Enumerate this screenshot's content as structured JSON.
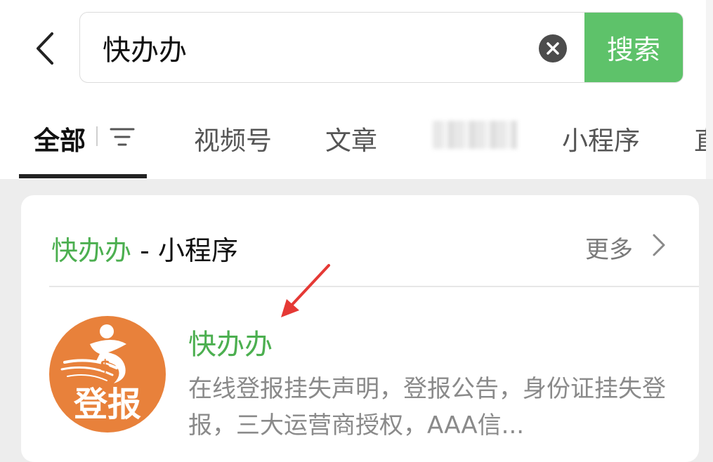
{
  "search": {
    "query": "快办办",
    "button_label": "搜索"
  },
  "tabs": [
    {
      "label": "全部"
    },
    {
      "label": "视频号"
    },
    {
      "label": "文章"
    },
    {
      "label": "小程序"
    },
    {
      "label": "直"
    }
  ],
  "section": {
    "keyword": "快办办",
    "suffix": " - 小程序",
    "more_label": "更多"
  },
  "result": {
    "name": "快办办",
    "logo_text": "登报",
    "description": "在线登报挂失声明，登报公告，身份证挂失登报，三大运营商授权，AAA信..."
  },
  "colors": {
    "accent_green": "#5ec26a",
    "keyword_green": "#4caf50",
    "logo_orange": "#e8813b",
    "annotation_red": "#e53935"
  },
  "icons": [
    "back-arrow-icon",
    "clear-icon",
    "filter-icon",
    "chevron-right-icon",
    "annotation-arrow-icon"
  ]
}
